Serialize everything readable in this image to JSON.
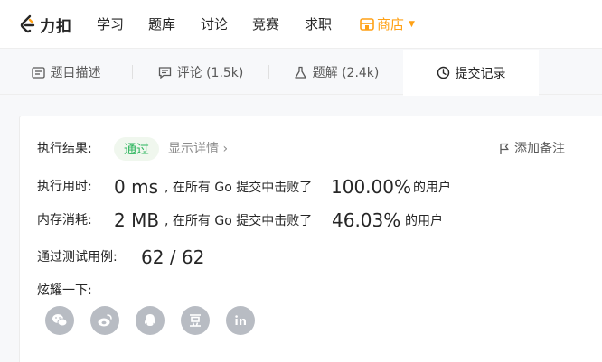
{
  "nav": {
    "logo_text": "力扣",
    "items": [
      "学习",
      "题库",
      "讨论",
      "竞赛",
      "求职"
    ],
    "shop_label": "商店",
    "accent_color": "#ffa116"
  },
  "tabs": [
    {
      "label": "题目描述",
      "icon": "description-icon"
    },
    {
      "label": "评论 (1.5k)",
      "icon": "comment-icon"
    },
    {
      "label": "题解 (2.4k)",
      "icon": "flask-icon"
    },
    {
      "label": "提交记录",
      "icon": "clock-icon",
      "active": true
    }
  ],
  "result": {
    "result_label": "执行结果:",
    "status": "通过",
    "status_color": "#2db55d",
    "details_link": "显示详情 ›",
    "add_note": "添加备注",
    "runtime_label": "执行用时:",
    "runtime_value": "0 ms",
    "runtime_middle": ", 在所有 Go 提交中击败了",
    "runtime_percent": "100.00%",
    "runtime_suffix": "的用户",
    "memory_label": "内存消耗:",
    "memory_value": "2 MB",
    "memory_middle": ", 在所有 Go 提交中击败了",
    "memory_percent": "46.03%",
    "memory_suffix": "的用户",
    "tests_label": "通过测试用例:",
    "tests_value": "62 / 62",
    "share_label": "炫耀一下:",
    "share_icons": [
      "wechat-icon",
      "weibo-icon",
      "qq-icon",
      "douban-icon",
      "linkedin-icon"
    ]
  }
}
